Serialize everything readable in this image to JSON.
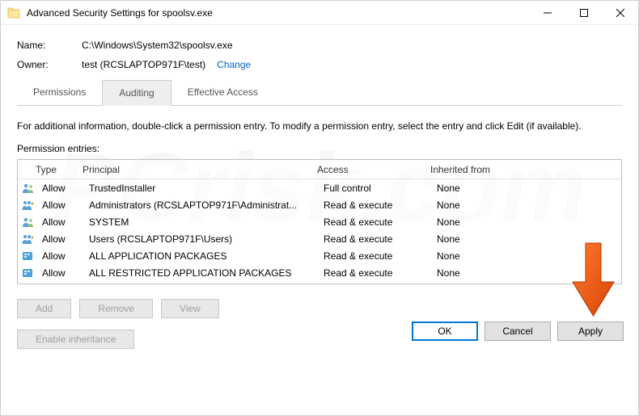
{
  "window": {
    "title": "Advanced Security Settings for spoolsv.exe"
  },
  "info": {
    "name_label": "Name:",
    "name_value": "C:\\Windows\\System32\\spoolsv.exe",
    "owner_label": "Owner:",
    "owner_value": "test (RCSLAPTOP971F\\test)",
    "change_label": "Change"
  },
  "tabs": {
    "permissions": "Permissions",
    "auditing": "Auditing",
    "effective": "Effective Access"
  },
  "instruction": "For additional information, double-click a permission entry. To modify a permission entry, select the entry and click Edit (if available).",
  "entries_label": "Permission entries:",
  "table": {
    "headers": {
      "type": "Type",
      "principal": "Principal",
      "access": "Access",
      "inherited": "Inherited from"
    },
    "rows": [
      {
        "icon": "user",
        "type": "Allow",
        "principal": "TrustedInstaller",
        "access": "Full control",
        "inherited": "None"
      },
      {
        "icon": "group",
        "type": "Allow",
        "principal": "Administrators (RCSLAPTOP971F\\Administrat...",
        "access": "Read & execute",
        "inherited": "None"
      },
      {
        "icon": "user",
        "type": "Allow",
        "principal": "SYSTEM",
        "access": "Read & execute",
        "inherited": "None"
      },
      {
        "icon": "group",
        "type": "Allow",
        "principal": "Users (RCSLAPTOP971F\\Users)",
        "access": "Read & execute",
        "inherited": "None"
      },
      {
        "icon": "pkg",
        "type": "Allow",
        "principal": "ALL APPLICATION PACKAGES",
        "access": "Read & execute",
        "inherited": "None"
      },
      {
        "icon": "pkg",
        "type": "Allow",
        "principal": "ALL RESTRICTED APPLICATION PACKAGES",
        "access": "Read & execute",
        "inherited": "None"
      }
    ]
  },
  "buttons": {
    "add": "Add",
    "remove": "Remove",
    "view": "View",
    "enable_inherit": "Enable inheritance",
    "ok": "OK",
    "cancel": "Cancel",
    "apply": "Apply"
  },
  "watermark": "PCrisk.com"
}
